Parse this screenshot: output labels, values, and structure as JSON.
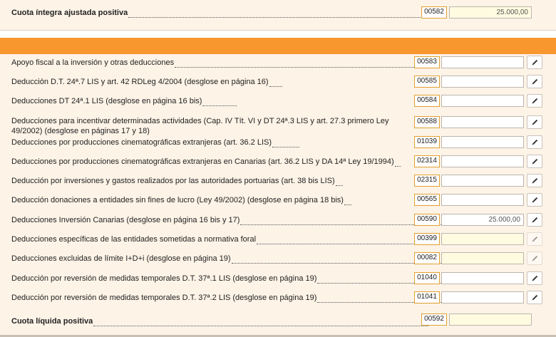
{
  "top": {
    "label": "Cuota íntegra ajustada positiva",
    "code": "00582",
    "value": "25.000,00"
  },
  "rows": [
    {
      "label": "Apoyo fiscal a la inversión y otras deducciones",
      "code": "00583",
      "value": ""
    },
    {
      "label": "Deducción D.T. 24ª.7 LIS y art. 42 RDLeg 4/2004 (desglose en página 16)",
      "code": "00585",
      "value": ""
    },
    {
      "label": "Deducciones DT 24ª.1 LIS (desglose en página 16 bis)",
      "code": "00584",
      "value": ""
    },
    {
      "label": "Deducciones para incentivar determinadas actividades (Cap. IV Tít. VI y DT 24ª.3 LIS y art. 27.3 primero Ley 49/2002) (desglose en páginas 17 y 18)",
      "code": "00588",
      "value": ""
    },
    {
      "label": "Deducciones por producciones cinematográficas extranjeras (art. 36.2 LIS)",
      "code": "01039",
      "value": ""
    },
    {
      "label": "Deducciones por producciones cinematográficas extranjeras en Canarias (art. 36.2 LIS y DA 14ª Ley 19/1994)",
      "code": "02314",
      "value": ""
    },
    {
      "label": "Deducción por inversiones y gastos realizados por las autoridades portuarias (art. 38 bis LIS)",
      "code": "02315",
      "value": ""
    },
    {
      "label": "Deducción donaciones a entidades sin fines de lucro (Ley 49/2002) (desglose en página 18 bis)",
      "code": "00565",
      "value": ""
    },
    {
      "label": "Deducciones Inversión Canarias (desglose en página 16 bis y 17)",
      "code": "00590",
      "value": "25.000,00"
    },
    {
      "label": "Deducciones específicas de las entidades sometidas a normativa foral",
      "code": "00399",
      "value": ""
    },
    {
      "label": "Deducciones excluidas de límite I+D+i (desglose en página 19)",
      "code": "00082",
      "value": ""
    },
    {
      "label": "Deducción por reversión de medidas temporales D.T. 37ª.1 LIS (desglose en página 19)",
      "code": "01040",
      "value": ""
    },
    {
      "label": "Deducción por reversión de medidas temporales D.T. 37ª.2 LIS (desglose en página 19)",
      "code": "01041",
      "value": ""
    }
  ],
  "bottom": {
    "label": "Cuota líquida positiva",
    "code": "00592",
    "value": ""
  },
  "colors": {
    "accent": "#f7972e",
    "panel": "#fdf3e7",
    "code_border": "#e0a030",
    "readonly_field": "#fffbe0"
  },
  "icons": {
    "edit": "pencil-icon"
  }
}
